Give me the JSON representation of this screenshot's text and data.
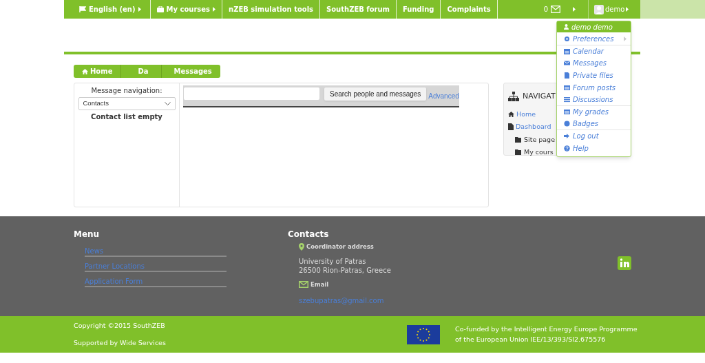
{
  "top_nav": {
    "items": [
      {
        "label": "English (en)",
        "caret": true
      },
      {
        "label": "My courses",
        "caret": true
      },
      {
        "label": "nZEB simulation tools",
        "caret": false
      },
      {
        "label": "SouthZEB forum",
        "caret": false
      },
      {
        "label": "Funding",
        "caret": false
      },
      {
        "label": "Complaints",
        "caret": false
      }
    ],
    "message_count": "0",
    "user": "demo"
  },
  "user_menu": {
    "header": "demo demo",
    "items": [
      {
        "label": "Preferences",
        "submenu": true,
        "divider_after": true
      },
      {
        "label": "Calendar",
        "submenu": false,
        "divider_after": false
      },
      {
        "label": "Messages",
        "submenu": false,
        "divider_after": false
      },
      {
        "label": "Private files",
        "submenu": false,
        "divider_after": false
      },
      {
        "label": "Forum posts",
        "submenu": false,
        "divider_after": false
      },
      {
        "label": "Discussions",
        "submenu": false,
        "divider_after": true
      },
      {
        "label": "My grades",
        "submenu": false,
        "divider_after": false
      },
      {
        "label": "Badges",
        "submenu": false,
        "divider_after": true
      },
      {
        "label": "Log out",
        "submenu": false,
        "divider_after": false
      },
      {
        "label": "Help",
        "submenu": false,
        "divider_after": false
      }
    ]
  },
  "breadcrumb": [
    "Home",
    "Da",
    "Messages"
  ],
  "messages": {
    "nav_label": "Message navigation:",
    "select_value": "Contacts",
    "empty_text": "Contact list empty",
    "search_button": "Search people and messages",
    "advanced_link": "Advanced"
  },
  "navigation_block": {
    "title": "NAVIGAT",
    "items": [
      {
        "label": "Home"
      },
      {
        "label": "Dashboard",
        "children": [
          {
            "label": "Site page"
          },
          {
            "label": "My cours"
          }
        ]
      }
    ]
  },
  "footer": {
    "menu_title": "Menu",
    "menu_links": [
      "News",
      "Partner Locations",
      "Application Form"
    ],
    "contacts_title": "Contacts",
    "address_label": "Coordinator address",
    "address_lines": [
      "University of Patras",
      "26500 Rion-Patras, Greece"
    ],
    "email_label": "Email",
    "email": "szebupatras@gmail.com"
  },
  "bottom_bar": {
    "copyright": "Copyright ©2015 SouthZEB",
    "supported": "Supported by Wide Services",
    "funding_lines": [
      "Co-funded by the Intelligent Energy Europe Programme",
      "of the European Union IEE/13/393/SI2.675576"
    ]
  }
}
